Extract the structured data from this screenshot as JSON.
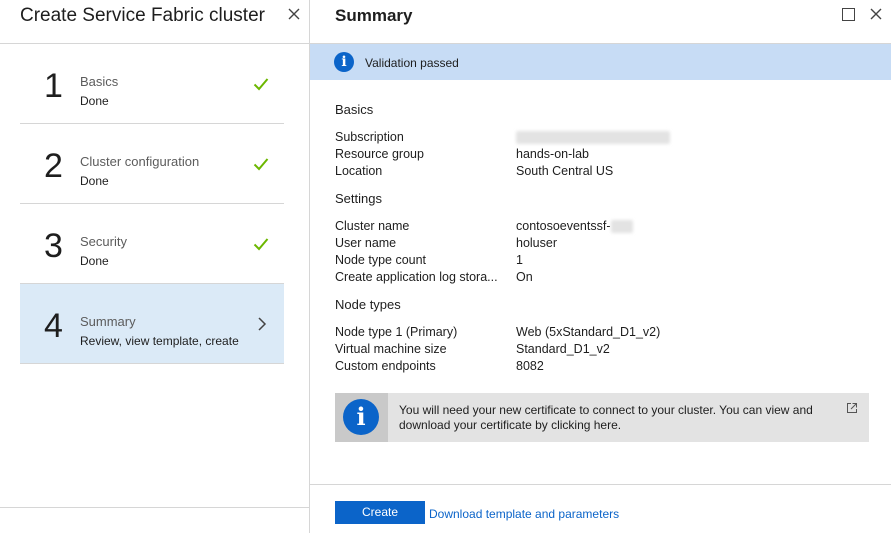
{
  "left": {
    "title": "Create Service Fabric cluster",
    "steps": [
      {
        "number": "1",
        "title": "Basics",
        "status": "Done",
        "icon": "check-icon"
      },
      {
        "number": "2",
        "title": "Cluster configuration",
        "status": "Done",
        "icon": "check-icon"
      },
      {
        "number": "3",
        "title": "Security",
        "status": "Done",
        "icon": "check-icon"
      },
      {
        "number": "4",
        "title": "Summary",
        "status": "Review, view template, create",
        "icon": "chevron-right-icon"
      }
    ]
  },
  "right": {
    "title": "Summary",
    "validation": {
      "text": "Validation passed",
      "icon": "info-icon"
    },
    "sections": [
      {
        "heading": "Basics",
        "rows": [
          {
            "key": "Subscription",
            "value": ""
          },
          {
            "key": "Resource group",
            "value": "hands-on-lab"
          },
          {
            "key": "Location",
            "value": "South Central US"
          }
        ]
      },
      {
        "heading": "Settings",
        "rows": [
          {
            "key": "Cluster name",
            "value": "contosoeventssf-"
          },
          {
            "key": "User name",
            "value": "holuser"
          },
          {
            "key": "Node type count",
            "value": "1"
          },
          {
            "key": "Create application log stora...",
            "value": "On"
          }
        ]
      },
      {
        "heading": "Node types",
        "rows": [
          {
            "key": "Node type 1 (Primary)",
            "value": "Web (5xStandard_D1_v2)"
          },
          {
            "key": "Virtual machine size",
            "value": "Standard_D1_v2"
          },
          {
            "key": "Custom endpoints",
            "value": "8082"
          }
        ]
      }
    ],
    "info_box": {
      "text": "You will need your new certificate to connect to your cluster. You can view and download your certificate by clicking here.",
      "icon": "info-icon",
      "link_icon": "external-link-icon"
    },
    "create_label": "Create",
    "download_label": "Download template and parameters"
  },
  "colors": {
    "accent": "#0b64c9",
    "success": "#6bb700",
    "selected_step_bg": "#dbeaf7",
    "validation_bg": "#c7dcf5"
  }
}
